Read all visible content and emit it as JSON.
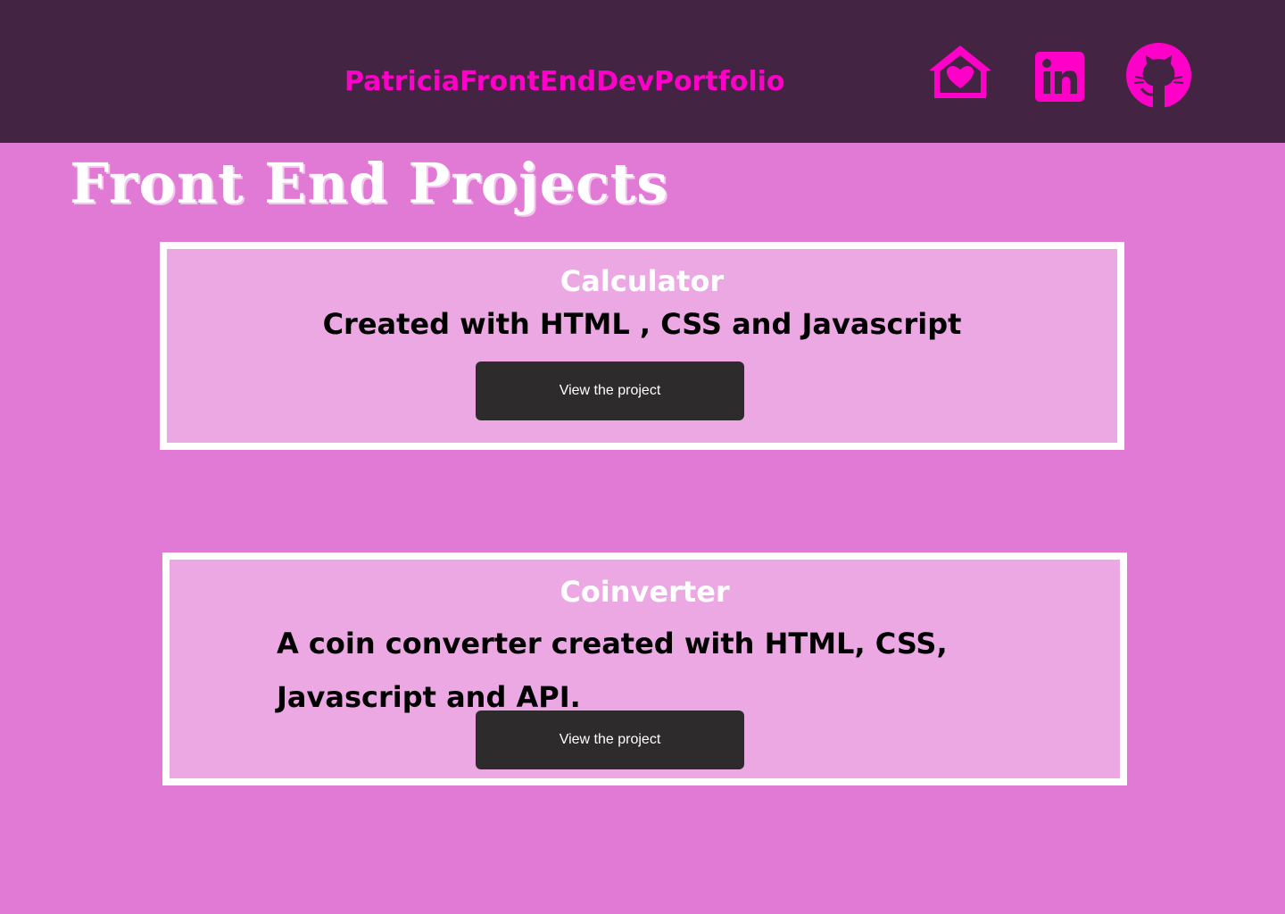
{
  "header": {
    "site_title": "PatriciaFrontEndDevPortfolio",
    "icons": [
      {
        "name": "home-heart-icon"
      },
      {
        "name": "linkedin-icon"
      },
      {
        "name": "github-icon"
      }
    ]
  },
  "main": {
    "heading": "Front End Projects",
    "projects": [
      {
        "title": "Calculator",
        "description": "Created with HTML , CSS and Javascript",
        "button_label": "View the project"
      },
      {
        "title": "Coinverter",
        "description": "A coin converter created with HTML, CSS, Javascript and API.",
        "button_label": "View the project"
      }
    ]
  },
  "colors": {
    "header_bg": "#432443",
    "page_bg": "#e17ad4",
    "card_bg": "#eca8e3",
    "accent": "#ff00c8",
    "button_bg": "#2e2b2d"
  }
}
